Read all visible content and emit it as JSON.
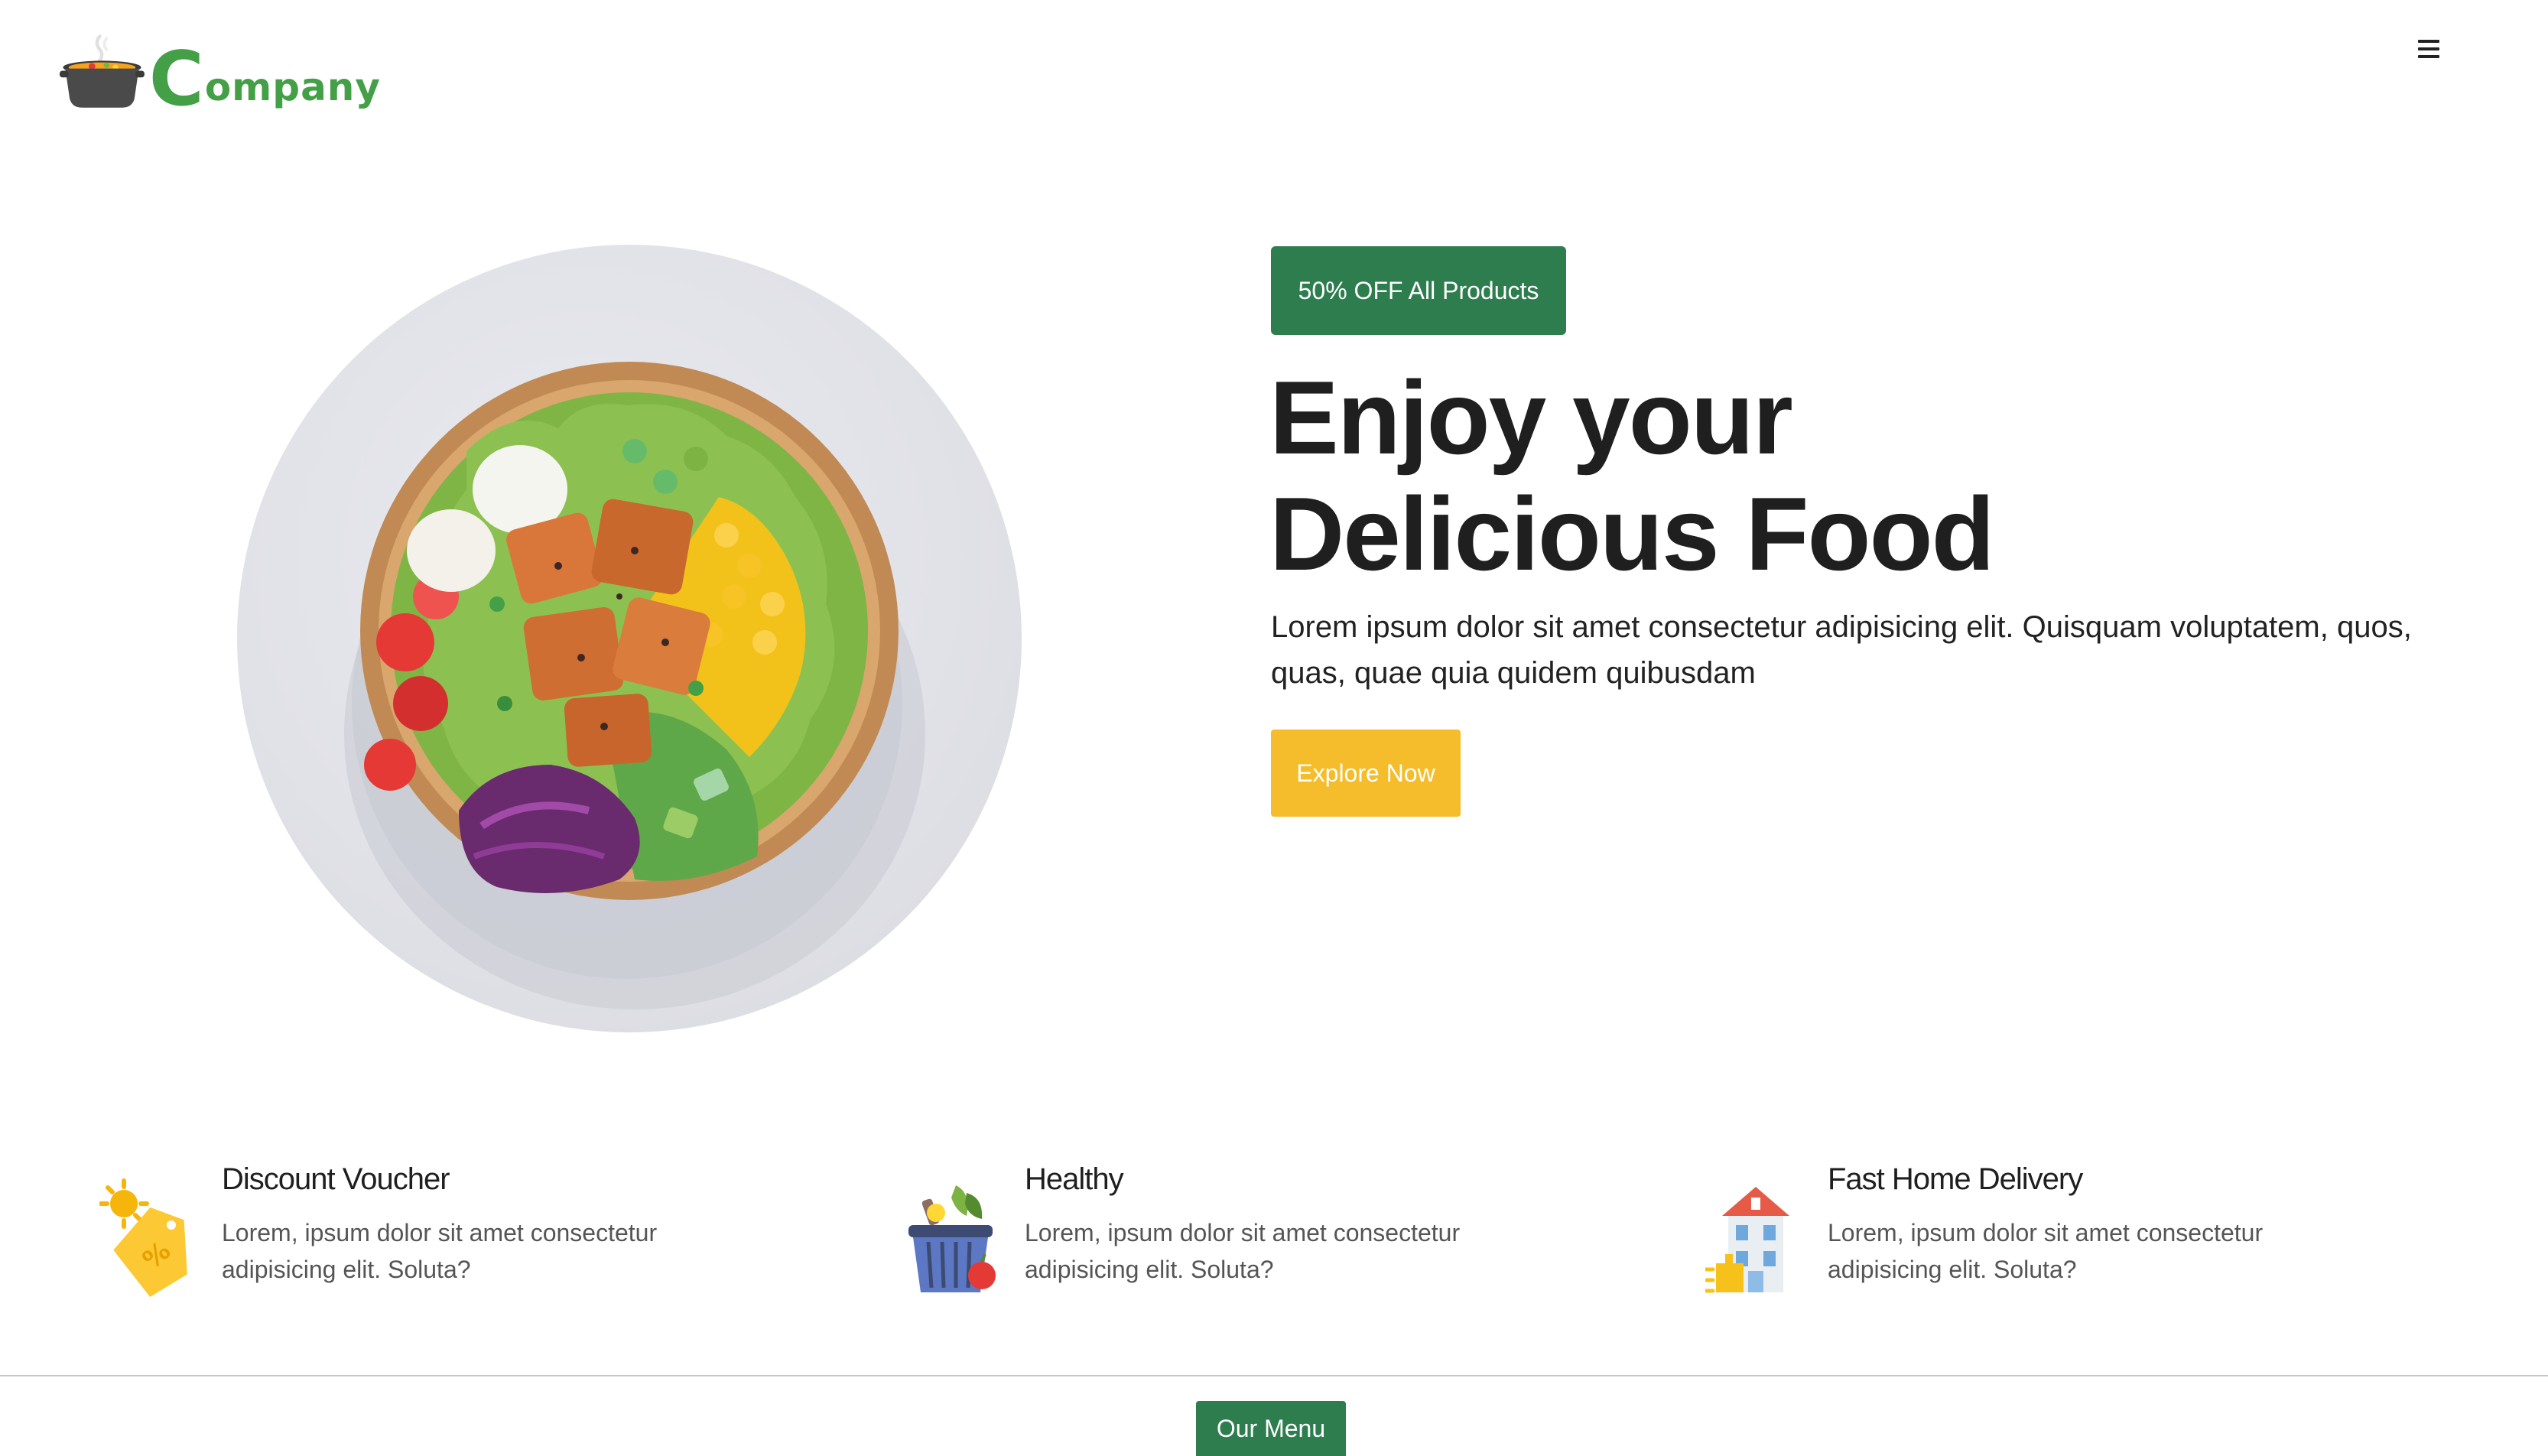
{
  "header": {
    "logo_initial": "C",
    "logo_rest": "ompany"
  },
  "hero": {
    "badge": "50% OFF All Products",
    "headline_line1": "Enjoy your",
    "headline_line2": "Delicious Food",
    "lead": "Lorem ipsum dolor sit amet consectetur adipisicing elit. Quisquam voluptatem, quos, quas, quae quia quidem quibusdam",
    "cta": "Explore Now"
  },
  "features": [
    {
      "icon": "discount-tag-icon",
      "title": "Discount Voucher",
      "desc": "Lorem, ipsum dolor sit amet consectetur adipisicing elit. Soluta?"
    },
    {
      "icon": "grocery-basket-icon",
      "title": "Healthy",
      "desc": "Lorem, ipsum dolor sit amet consectetur adipisicing elit. Soluta?"
    },
    {
      "icon": "delivery-house-icon",
      "title": "Fast Home Delivery",
      "desc": "Lorem, ipsum dolor sit amet consectetur adipisicing elit. Soluta?"
    }
  ],
  "section": {
    "our_menu": "Our Menu"
  },
  "colors": {
    "brand_green": "#2e7d4f",
    "logo_green": "#43a047",
    "cta_yellow": "#f5bd2b"
  }
}
